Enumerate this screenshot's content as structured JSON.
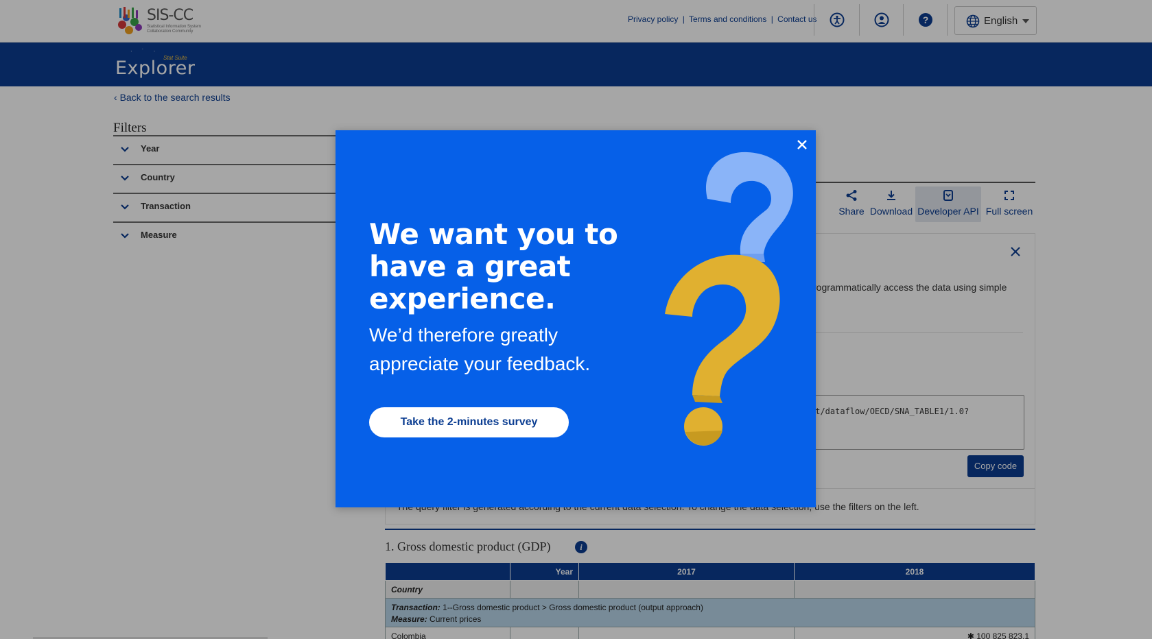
{
  "header": {
    "logo_title": "SIS-CC",
    "logo_subtitle": "Statistical Information System Collaboration Community",
    "links": [
      "Privacy policy",
      "Terms and conditions",
      "Contact us"
    ],
    "separator": "|",
    "language": "English",
    "icons": [
      "accessibility-icon",
      "user-icon",
      "help-icon",
      "globe-icon"
    ]
  },
  "band": {
    "app_name": "Explorer",
    "tagline": "Stat Suite"
  },
  "nav": {
    "back_link": "Back to the search results"
  },
  "filters": {
    "title": "Filters",
    "items": [
      {
        "label": "Year"
      },
      {
        "label": "Country"
      },
      {
        "label": "Transaction"
      },
      {
        "label": "Measure"
      }
    ]
  },
  "toolbar": {
    "share": "Share",
    "download": "Download",
    "developer_api": "Developer API",
    "full_screen": "Full screen"
  },
  "api_panel": {
    "description_fragment": "rogrammatically access the data using simple",
    "query_fragment": "st/dataflow/OECD/SNA_TABLE1/1.0?",
    "copy_label": "Copy code",
    "note": "The query filter is generated according to the current data selection. To change the data selection, use the filters on the left."
  },
  "table": {
    "title": "1. Gross domestic product (GDP)",
    "info": "i",
    "year_label": "Year",
    "years": [
      "2017",
      "2018"
    ],
    "country_label": "Country",
    "transaction_label": "Transaction:",
    "transaction_value": "1--Gross domestic product > Gross domestic product (output approach)",
    "measure_label": "Measure:",
    "measure_value": "Current prices",
    "first_row_country": "Colombia",
    "first_row_value": "✱ 100 825 823.1"
  },
  "modal": {
    "headline": "We want you to have a great experience.",
    "subline": "We’d therefore greatly appreciate your feedback.",
    "button": "Take the 2-minutes survey",
    "colors": {
      "background": "#0660e8",
      "question_yellow": "#e0b030",
      "question_light_blue": "#8ab4f8"
    }
  }
}
